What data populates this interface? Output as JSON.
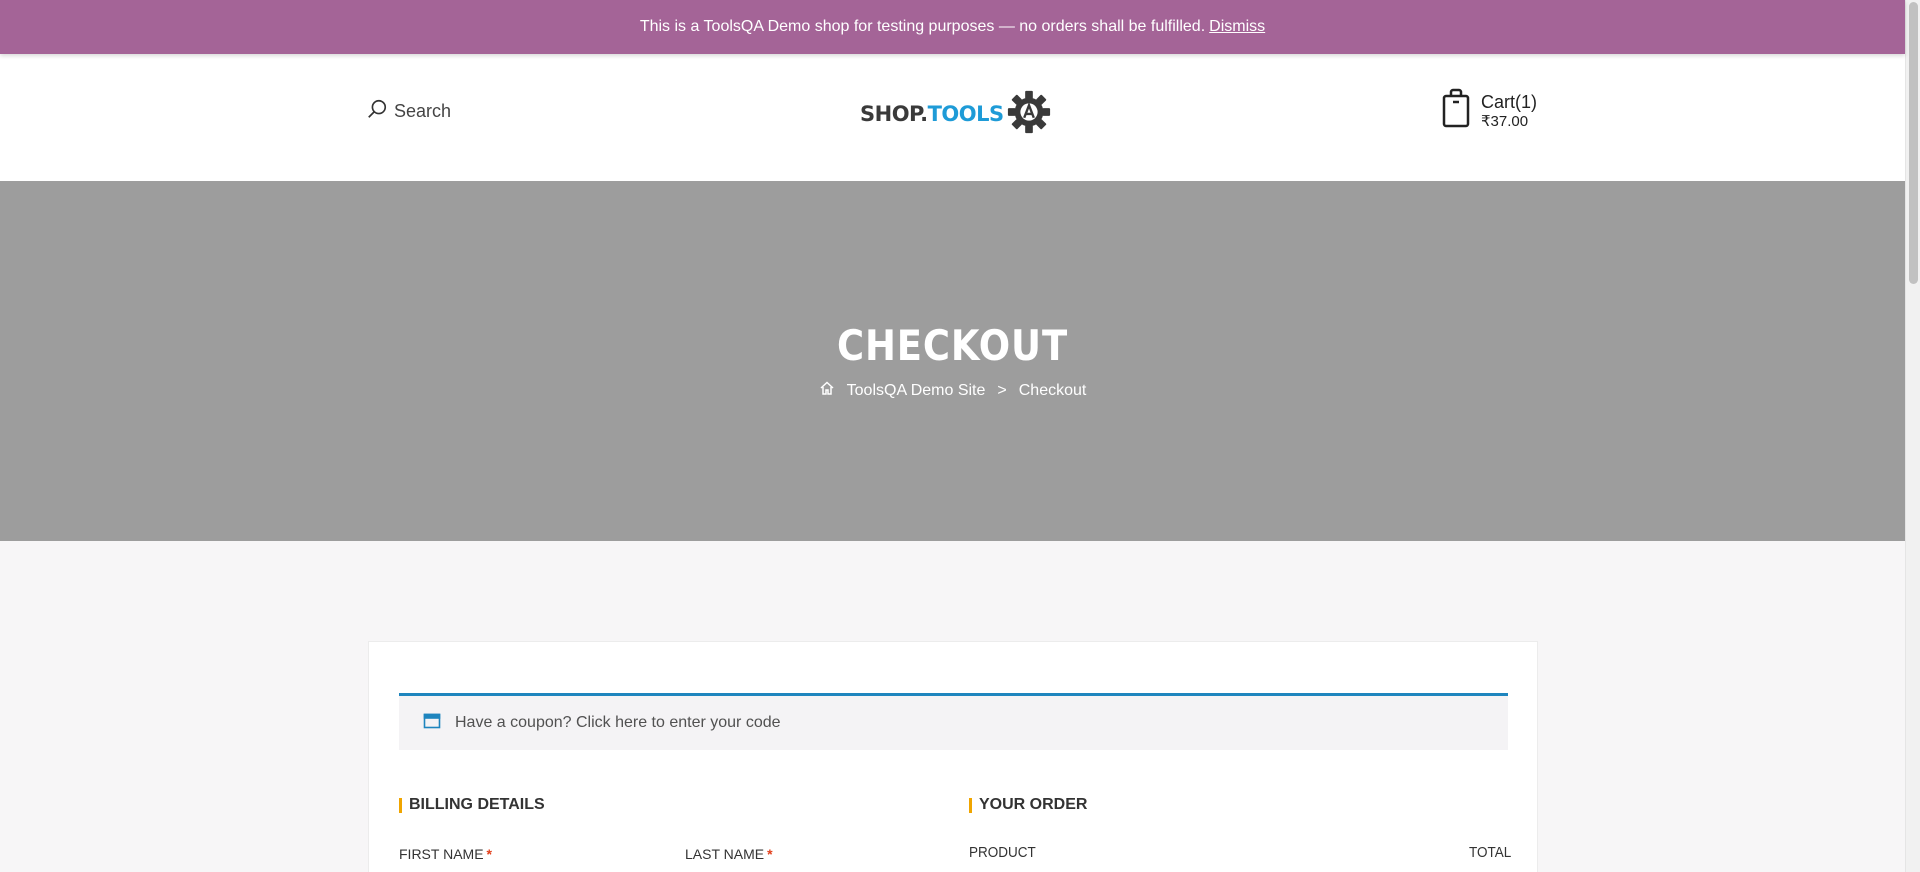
{
  "notice": {
    "text": "This is a ToolsQA Demo shop for testing purposes — no orders shall be fulfilled.",
    "dismiss_label": "Dismiss",
    "bg_color": "#a46497"
  },
  "header": {
    "search_label": "Search",
    "search_icon": "search-icon",
    "logo": {
      "text_dark": "SHOP.",
      "text_blue": "TOOLS",
      "icon": "gear-a-icon"
    },
    "cart": {
      "label": "Cart(1)",
      "amount": "₹37.00",
      "icon": "shopping-bag-icon"
    }
  },
  "hero": {
    "title": "CHECKOUT",
    "breadcrumb": [
      {
        "label": "ToolsQA Demo Site",
        "icon": "home-icon"
      },
      {
        "label": "Checkout"
      }
    ],
    "separator": ">"
  },
  "coupon": {
    "text": "Have a coupon? Click here to enter your code",
    "icon": "calendar-icon",
    "accent_color": "#1e85be"
  },
  "billing": {
    "heading": "BILLING DETAILS",
    "first_name_label": "FIRST NAME",
    "last_name_label": "LAST NAME",
    "required_mark": "*"
  },
  "order": {
    "heading": "YOUR ORDER",
    "columns": [
      "PRODUCT",
      "TOTAL"
    ]
  },
  "accent_heading_color": "#f0a500"
}
